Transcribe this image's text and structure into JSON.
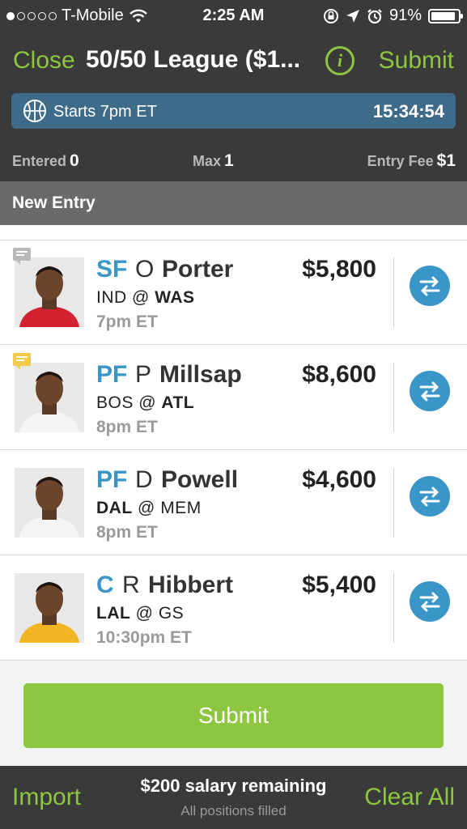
{
  "status_bar": {
    "carrier": "T-Mobile",
    "time": "2:25 AM",
    "battery": "91%",
    "battery_level": 0.91,
    "signal_bars_filled": 1
  },
  "nav": {
    "close_label": "Close",
    "title": "50/50 League ($1...",
    "info_label": "i",
    "submit_label": "Submit"
  },
  "banner": {
    "starts_label": "Starts 7pm ET",
    "countdown": "15:34:54",
    "icon": "basketball-icon"
  },
  "stats": {
    "entered_label": "Entered",
    "entered_value": "0",
    "max_label": "Max",
    "max_value": "1",
    "fee_label": "Entry Fee",
    "fee_value": "$1"
  },
  "entry_bar": {
    "label": "New Entry"
  },
  "players": [
    {
      "pos": "SF",
      "first": "O",
      "last": "Porter",
      "salary": "$5,800",
      "team1": "IND",
      "at": "@",
      "team2": "WAS",
      "bold_team": 2,
      "time": "7pm ET",
      "note_color": "#b9b9b9",
      "jersey": "#d4212f"
    },
    {
      "pos": "PF",
      "first": "P",
      "last": "Millsap",
      "salary": "$8,600",
      "team1": "BOS",
      "at": "@",
      "team2": "ATL",
      "bold_team": 2,
      "time": "8pm ET",
      "note_color": "#f3c94a",
      "jersey": "#f4f4f4"
    },
    {
      "pos": "PF",
      "first": "D",
      "last": "Powell",
      "salary": "$4,600",
      "team1": "DAL",
      "at": "@",
      "team2": "MEM",
      "bold_team": 1,
      "time": "8pm ET",
      "note_color": "",
      "jersey": "#f4f4f4"
    },
    {
      "pos": "C",
      "first": "R",
      "last": "Hibbert",
      "salary": "$5,400",
      "team1": "LAL",
      "at": "@",
      "team2": "GS",
      "bold_team": 1,
      "time": "10:30pm ET",
      "note_color": "",
      "jersey": "#f2b623"
    }
  ],
  "submit_button": {
    "label": "Submit"
  },
  "footer": {
    "import_label": "Import",
    "salary_remaining": "$200 salary remaining",
    "positions_status": "All positions filled",
    "clear_label": "Clear All"
  },
  "colors": {
    "accent": "#8dc63f",
    "position": "#3a95c9",
    "dark": "#3a3a3a"
  }
}
